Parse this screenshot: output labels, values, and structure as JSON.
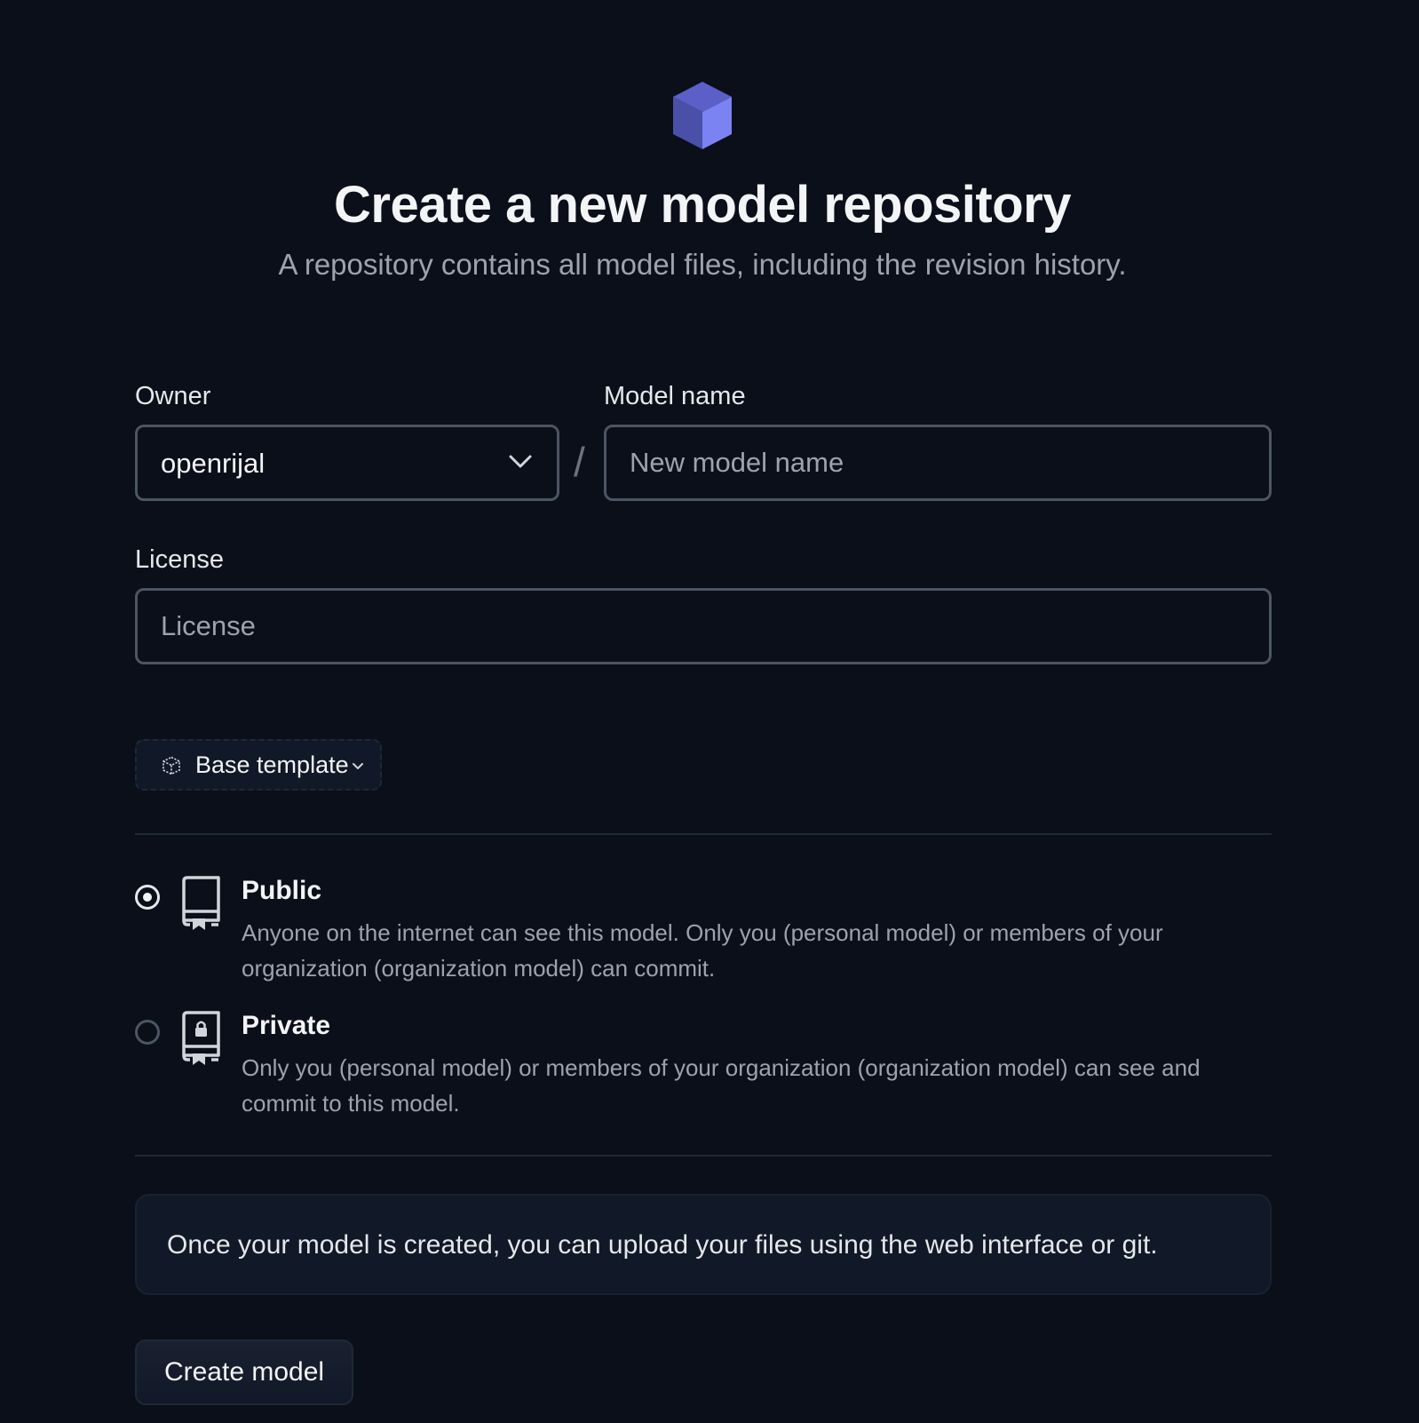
{
  "header": {
    "logo_icon": "cube-icon",
    "title": "Create a new model repository",
    "subtitle": "A repository contains all model files, including the revision history."
  },
  "form": {
    "owner": {
      "label": "Owner",
      "selected": "openrijal",
      "icon": "chevron-down-icon"
    },
    "separator": "/",
    "model_name": {
      "label": "Model name",
      "value": "",
      "placeholder": "New model name"
    },
    "license": {
      "label": "License",
      "value": "",
      "placeholder": "License"
    },
    "template_button": {
      "icon": "cube-outline-icon",
      "label": "Base template"
    },
    "visibility": {
      "selected": "public",
      "options": [
        {
          "id": "public",
          "icon": "repo-icon",
          "title": "Public",
          "description": "Anyone on the internet can see this model. Only you (personal model) or members of your organization (organization model) can commit."
        },
        {
          "id": "private",
          "icon": "repo-locked-icon",
          "title": "Private",
          "description": "Only you (personal model) or members of your organization (organization model) can see and commit to this model."
        }
      ]
    },
    "info": "Once your model is created, you can upload your files using the web interface or git.",
    "submit_label": "Create model"
  },
  "colors": {
    "background": "#0b0f19",
    "accent": "#818cf8",
    "accent_dark": "#4f46e5",
    "border": "#4b5563",
    "muted_text": "#9ca3af"
  }
}
